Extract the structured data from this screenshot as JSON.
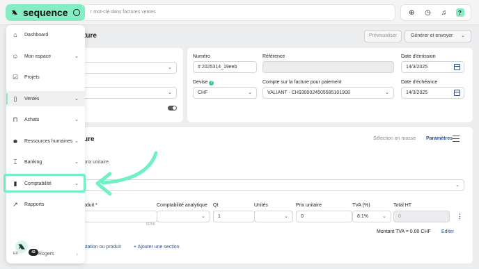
{
  "brand": {
    "name": "sequence"
  },
  "search": {
    "placeholder": "r mot-clé dans factures ventes"
  },
  "header": {
    "title": "ture",
    "preview_label": "Prévisualiser",
    "generate_label": "Générer et envoyer"
  },
  "form": {
    "numero_label": "Numéro",
    "numero_value": "# 2025314_19eeb",
    "reference_label": "Référence",
    "reference_value": "",
    "date_emission_label": "Date d'émission",
    "date_emission_value": "14/3/2025",
    "devise_label": "Devise",
    "devise_value": "CHF",
    "compte_label": "Compte sur la facture pour paiement",
    "compte_value": "VALIANT - CH9300024505585101908",
    "date_echeance_label": "Date d'échéance",
    "date_echeance_value": "14/3/2025"
  },
  "section": {
    "title": "ure",
    "masse_label": "Sélection en masse",
    "params_label": "Paramètres",
    "prix_unitaire_note": "prix unitaire"
  },
  "table": {
    "headers": {
      "produit": "oduit *",
      "compta": "Comptabilité analytique",
      "qt": "Qt",
      "unites": "Unités",
      "prix": "Prix unitaire",
      "tva": "TVA (%)",
      "total": "Total HT"
    },
    "row": {
      "qt": "1",
      "prix": "0",
      "tva": "8.1%",
      "total": "0"
    },
    "counter": "0/255"
  },
  "summary": {
    "tva_total": "Montant TVA = 0.00 CHF",
    "edit_label": "Editer"
  },
  "actions": {
    "add_item": "station ou produit",
    "add_section": "+ Ajouter une section"
  },
  "sidebar": {
    "items": [
      {
        "label": "Dashboard"
      },
      {
        "label": "Mon espace"
      },
      {
        "label": "Projets"
      },
      {
        "label": "Ventes"
      },
      {
        "label": "Achats"
      },
      {
        "label": "Ressources humaines"
      },
      {
        "label": "Banking"
      },
      {
        "label": "Comptabilité"
      },
      {
        "label": "Rapports"
      }
    ]
  },
  "user": {
    "initials": "ER",
    "badge": "42",
    "name": "Rogers"
  },
  "colors": {
    "accent": "#86ecc4",
    "highlight": "#6ff0c7",
    "link": "#2f4e8a"
  }
}
